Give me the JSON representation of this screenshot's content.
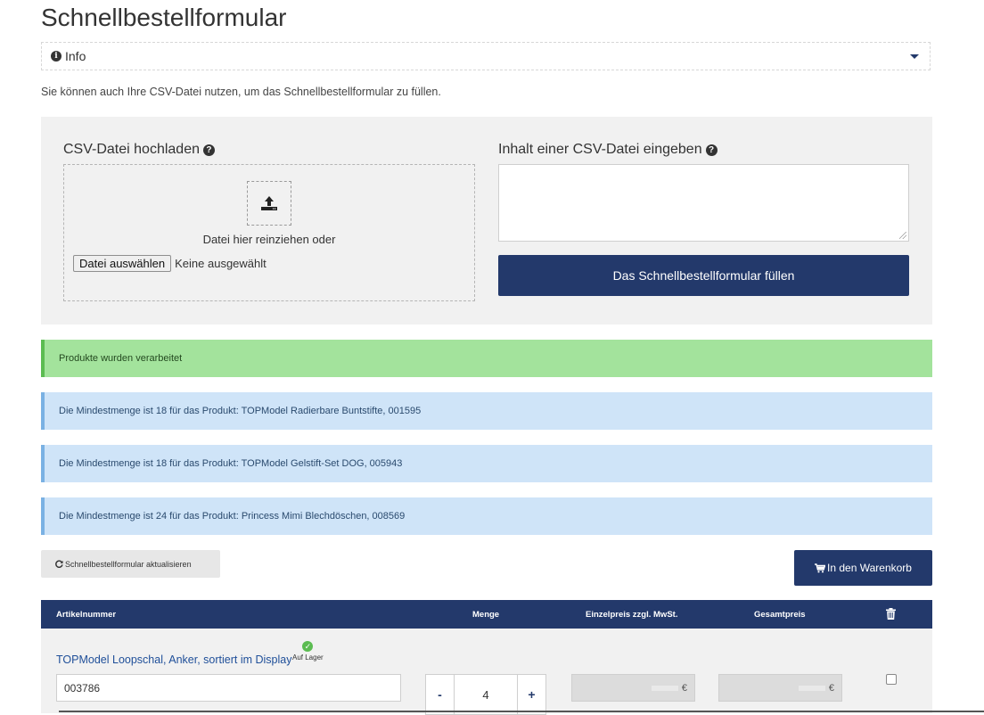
{
  "page": {
    "title": "Schnellbestellformular"
  },
  "info": {
    "label": "Info"
  },
  "csv_hint": "Sie können auch Ihre CSV-Datei nutzen, um das Schnellbestellformular zu füllen.",
  "upload": {
    "heading": "CSV-Datei hochladen",
    "drop_text": "Datei hier reinziehen oder",
    "file_button": "Datei auswählen",
    "file_status": "Keine ausgewählt"
  },
  "csv_input": {
    "heading": "Inhalt einer CSV-Datei eingeben",
    "value": "",
    "submit_label": "Das Schnellbestellformular füllen"
  },
  "alerts": [
    {
      "type": "success",
      "text": "Produkte wurden verarbeitet"
    },
    {
      "type": "info",
      "text": "Die Mindestmenge ist 18 für das Produkt: TOPModel Radierbare Buntstifte, 001595"
    },
    {
      "type": "info",
      "text": "Die Mindestmenge ist 18 für das Produkt: TOPModel Gelstift-Set DOG, 005943"
    },
    {
      "type": "info",
      "text": "Die Mindestmenge ist 24 für das Produkt: Princess Mimi Blechdöschen, 008569"
    }
  ],
  "actions": {
    "refresh_label": "Schnellbestellformular aktualisieren",
    "cart_label": "In den Warenkorb"
  },
  "table": {
    "headers": {
      "article": "Artikelnummer",
      "quantity": "Menge",
      "unit_price": "Einzelpreis zzgl. MwSt.",
      "total": "Gesamtpreis"
    },
    "rows": [
      {
        "product": "TOPModel Loopschal, Anker, sortiert im Display",
        "stock": "Auf Lager",
        "sku": "003786",
        "quantity": "4",
        "minus": "-",
        "plus": "+",
        "currency": "€"
      }
    ]
  },
  "colors": {
    "primary": "#23396b",
    "success_bg": "#a3e39c",
    "info_bg": "#cfe4f8",
    "panel_bg": "#f1f1f1"
  }
}
